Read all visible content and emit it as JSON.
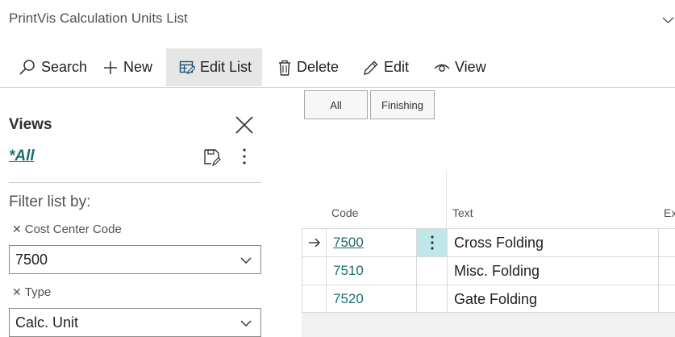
{
  "page": {
    "title": "PrintVis Calculation Units List"
  },
  "actions": [
    {
      "label": "Search",
      "icon": "search-icon"
    },
    {
      "label": "New",
      "icon": "plus-icon"
    },
    {
      "label": "Edit List",
      "icon": "edit-list-icon",
      "active": true
    },
    {
      "label": "Delete",
      "icon": "trash-icon"
    },
    {
      "label": "Edit",
      "icon": "pencil-icon"
    },
    {
      "label": "View",
      "icon": "eye-icon"
    }
  ],
  "views": {
    "heading": "Views",
    "current_view": "*All",
    "filter_heading": "Filter list by:",
    "filters": [
      {
        "label": "Cost Center Code",
        "value": "7500"
      },
      {
        "label": "Type",
        "value": "Calc. Unit"
      }
    ]
  },
  "tabs": [
    "All",
    "Finishing"
  ],
  "columns": {
    "code": "Code",
    "text": "Text",
    "extra": "Ex"
  },
  "rows": [
    {
      "code": "7500",
      "text": "Cross Folding",
      "selected": true
    },
    {
      "code": "7510",
      "text": "Misc. Folding",
      "selected": false
    },
    {
      "code": "7520",
      "text": "Gate Folding",
      "selected": false
    }
  ],
  "colors": {
    "accent": "#1d6c70",
    "selected_cell": "#bfe6e8",
    "active_action_bg": "#e6e6e6"
  }
}
